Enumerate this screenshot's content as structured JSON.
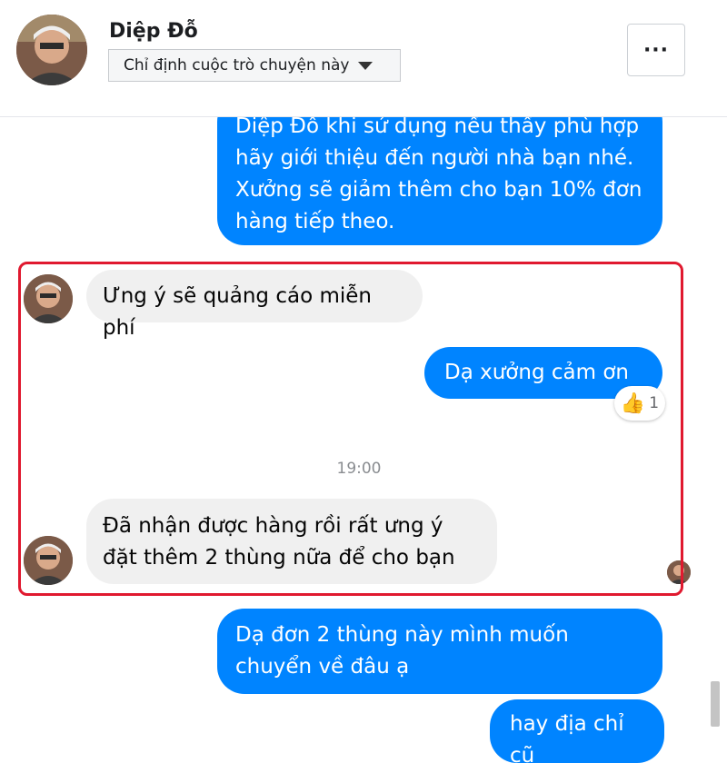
{
  "header": {
    "contact_name": "Diệp Đỗ",
    "assign_label": "Chỉ định cuộc trò chuyện này",
    "more_label": "···"
  },
  "messages": [
    {
      "direction": "out",
      "text": "Diệp Đỗ khi sử dụng nếu thấy phù hợp hãy giới thiệu đến người nhà bạn nhé. Xưởng sẽ giảm thêm cho bạn 10% đơn hàng tiếp theo."
    },
    {
      "direction": "in",
      "text": "Ưng ý sẽ quảng cáo miễn phí"
    },
    {
      "direction": "out",
      "text": "Dạ xưởng cảm ơn ạ",
      "reaction": {
        "emoji": "👍",
        "count": "1"
      }
    },
    {
      "direction": "in",
      "text": "Đã nhận được hàng rồi rất ưng ý đặt thêm 2 thùng nữa để  cho bạn"
    },
    {
      "direction": "out",
      "text": "Dạ đơn 2 thùng này mình muốn chuyển về đâu ạ"
    },
    {
      "direction": "out",
      "text": "hay địa chỉ cũ"
    }
  ],
  "timestamp": "19:00",
  "colors": {
    "outgoing_bubble": "#0084ff",
    "incoming_bubble": "#f0f0f0",
    "highlight_border": "#e0192f"
  },
  "icons": {
    "avatar": "contact-avatar",
    "reaction": "thumbs-up-icon",
    "more": "ellipsis-icon",
    "caret": "caret-down-icon"
  }
}
